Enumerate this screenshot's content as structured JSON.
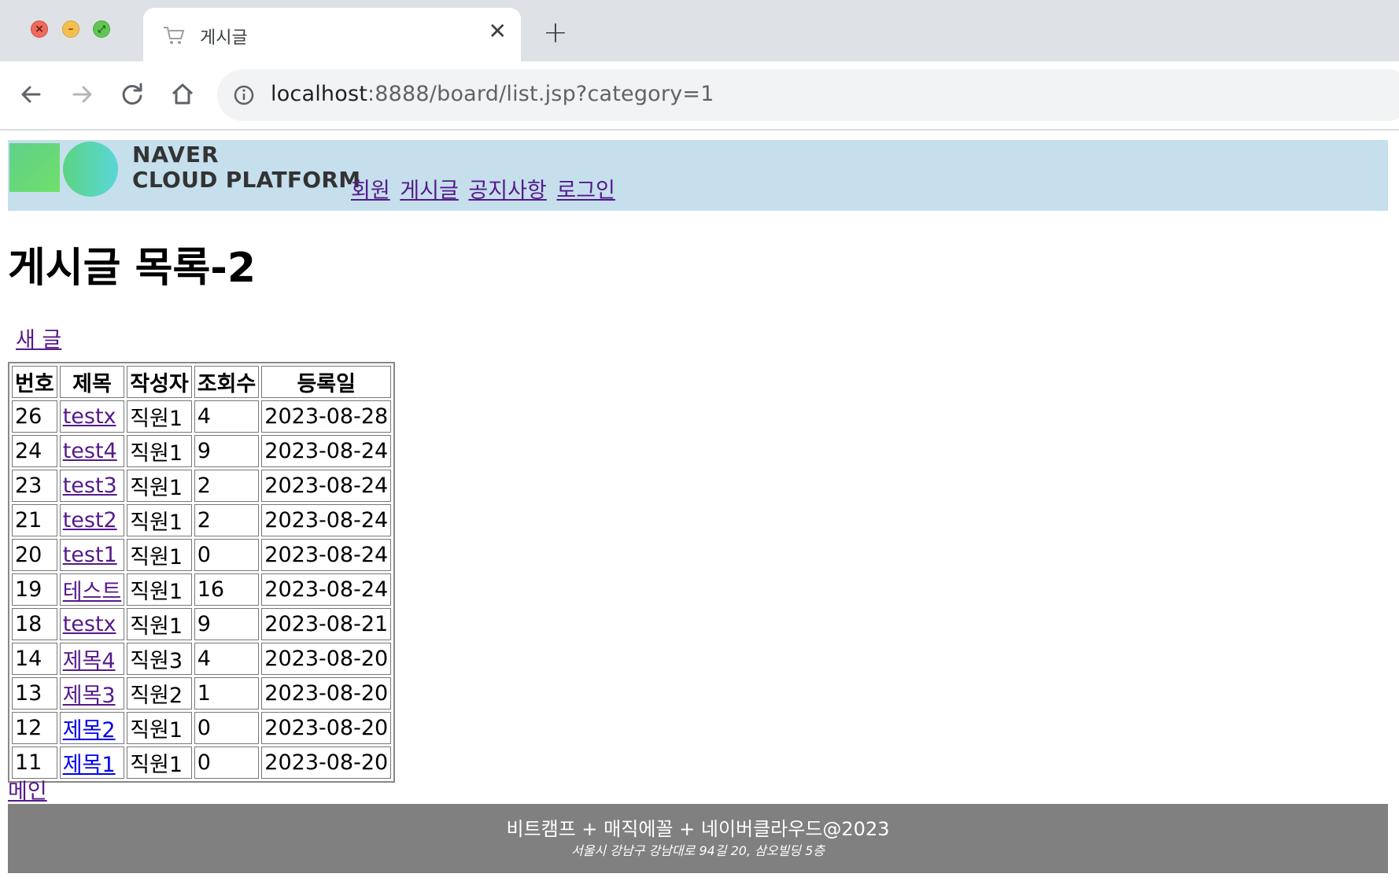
{
  "browser": {
    "tab_title": "게시글",
    "url_host": "localhost",
    "url_rest": ":8888/board/list.jsp?category=1"
  },
  "header": {
    "logo_line1": "NAVER",
    "logo_line2": "CLOUD PLATFORM",
    "menu": [
      "회원",
      "게시글",
      "공지사항",
      "로그인"
    ]
  },
  "page": {
    "title": "게시글 목록-2",
    "new_post": "새 글",
    "main_link": "메인"
  },
  "table": {
    "headers": [
      "번호",
      "제목",
      "작성자",
      "조회수",
      "등록일"
    ],
    "rows": [
      {
        "no": "26",
        "title": "testx",
        "writer": "직원1",
        "views": "4",
        "date": "2023-08-28"
      },
      {
        "no": "24",
        "title": "test4",
        "writer": "직원1",
        "views": "9",
        "date": "2023-08-24"
      },
      {
        "no": "23",
        "title": "test3",
        "writer": "직원1",
        "views": "2",
        "date": "2023-08-24"
      },
      {
        "no": "21",
        "title": "test2",
        "writer": "직원1",
        "views": "2",
        "date": "2023-08-24"
      },
      {
        "no": "20",
        "title": "test1",
        "writer": "직원1",
        "views": "0",
        "date": "2023-08-24"
      },
      {
        "no": "19",
        "title": "테스트",
        "writer": "직원1",
        "views": "16",
        "date": "2023-08-24"
      },
      {
        "no": "18",
        "title": "testx",
        "writer": "직원1",
        "views": "9",
        "date": "2023-08-21"
      },
      {
        "no": "14",
        "title": "제목4",
        "writer": "직원3",
        "views": "4",
        "date": "2023-08-20"
      },
      {
        "no": "13",
        "title": "제목3",
        "writer": "직원2",
        "views": "1",
        "date": "2023-08-20"
      },
      {
        "no": "12",
        "title": "제목2",
        "writer": "직원1",
        "views": "0",
        "date": "2023-08-20"
      },
      {
        "no": "11",
        "title": "제목1",
        "writer": "직원1",
        "views": "0",
        "date": "2023-08-20"
      }
    ]
  },
  "footer": {
    "main": "비트캠프 + 매직에꼴 + 네이버클라우드@2023",
    "address": "서울시 강남구 강남대로 94길 20, 삼오빌딩 5층"
  },
  "colors": {
    "header_bg": "#c5dfed",
    "footer_bg": "#808080",
    "visited_link": "#551a8b",
    "unvisited_link": "#0000ee"
  }
}
